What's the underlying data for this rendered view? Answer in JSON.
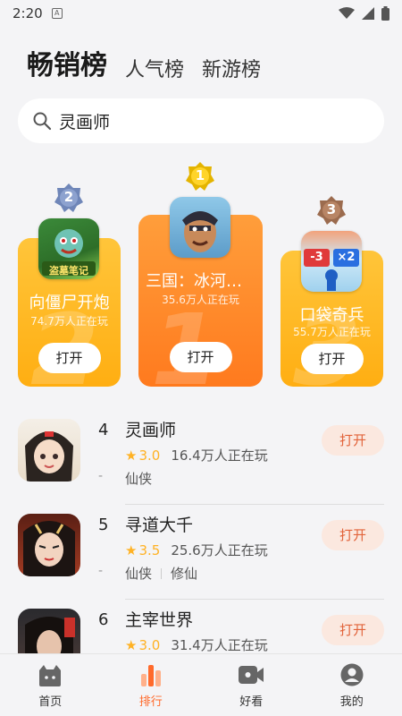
{
  "status": {
    "time": "2:20",
    "notif_icon": "A"
  },
  "tabs": [
    {
      "label": "畅销榜",
      "active": true
    },
    {
      "label": "人气榜"
    },
    {
      "label": "新游榜"
    }
  ],
  "search": {
    "value": "灵画师",
    "placeholder": ""
  },
  "podium": {
    "first": {
      "rank": "1",
      "title": "三国：冰河时…",
      "players": "35.6万人正在玩",
      "button": "打开"
    },
    "second": {
      "rank": "2",
      "title": "向僵尸开炮",
      "players": "74.7万人正在玩",
      "button": "打开",
      "icon_text": "盗墓笔记"
    },
    "third": {
      "rank": "3",
      "title": "口袋奇兵",
      "players": "55.7万人正在玩",
      "button": "打开",
      "icon_text_a": "-3",
      "icon_text_b": "×2"
    }
  },
  "list": [
    {
      "rank": "4",
      "name": "灵画师",
      "star": "★",
      "score": "3.0",
      "players": "16.4万人正在玩",
      "dash": "-",
      "tags": [
        "仙侠"
      ],
      "button": "打开"
    },
    {
      "rank": "5",
      "name": "寻道大千",
      "star": "★",
      "score": "3.5",
      "players": "25.6万人正在玩",
      "dash": "-",
      "tags": [
        "仙侠",
        "修仙"
      ],
      "button": "打开"
    },
    {
      "rank": "6",
      "name": "主宰世界",
      "star": "★",
      "score": "3.0",
      "players": "31.4万人正在玩",
      "dash": "-",
      "tags": [],
      "button": "打开"
    }
  ],
  "nav": [
    {
      "label": "首页",
      "icon": "home-icon"
    },
    {
      "label": "排行",
      "icon": "ranking-icon",
      "active": true
    },
    {
      "label": "好看",
      "icon": "video-icon"
    },
    {
      "label": "我的",
      "icon": "profile-icon"
    }
  ],
  "colors": {
    "accent": "#ff6a2b",
    "gold": "#ffb224",
    "pill_bg": "#fbe8df"
  }
}
